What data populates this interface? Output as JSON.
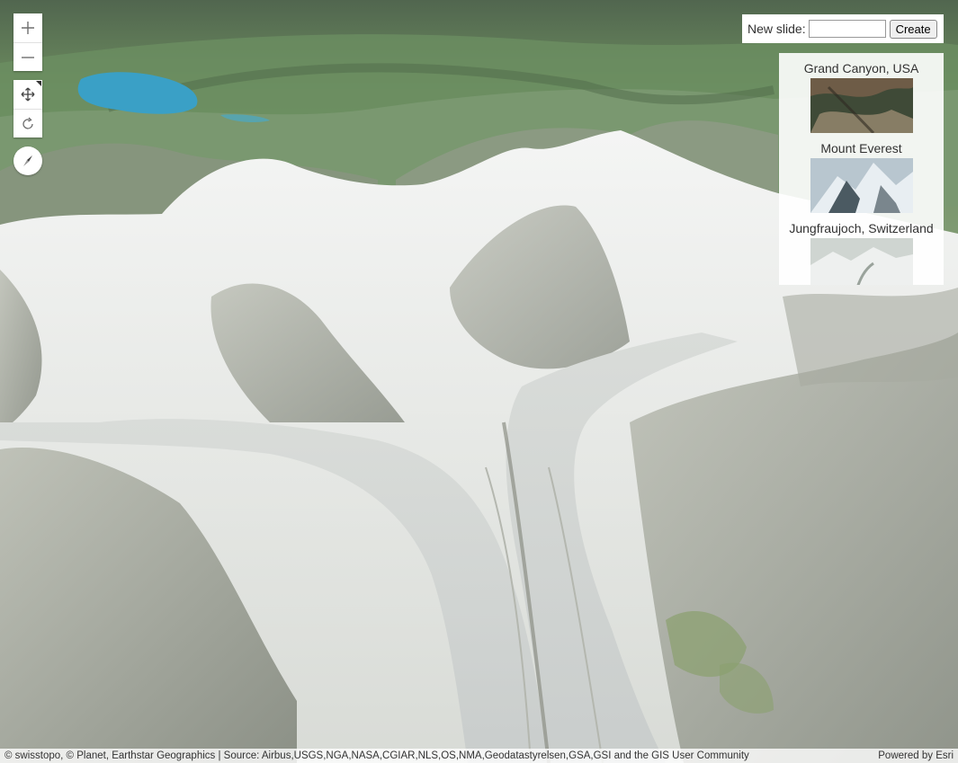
{
  "zoom": {
    "in_icon": "plus-icon",
    "out_icon": "minus-icon"
  },
  "navigation": {
    "pan_icon": "pan-arrows-icon",
    "rotate_icon": "rotate-icon",
    "compass_icon": "compass-icon"
  },
  "create_slide": {
    "label": "New slide:",
    "input_value": "",
    "button_label": "Create"
  },
  "slides": [
    {
      "title": "Grand Canyon, USA",
      "thumb_colors": [
        "#6e5c47",
        "#3f4a37",
        "#9a8a70"
      ]
    },
    {
      "title": "Mount Everest",
      "thumb_colors": [
        "#e8eef2",
        "#4b5a62",
        "#b8c6cf"
      ]
    },
    {
      "title": "Jungfraujoch, Switzerland",
      "thumb_colors": [
        "#eef0ef",
        "#9aa39c",
        "#cfd5d1"
      ]
    }
  ],
  "attribution": {
    "text": "© swisstopo, © Planet, Earthstar Geographics | Source: Airbus,USGS,NGA,NASA,CGIAR,NLS,OS,NMA,Geodatastyrelsen,GSA,GSI and the GIS User Community",
    "powered_by": "Powered by Esri"
  },
  "colors": {
    "lake": "#3aa0c6",
    "forest": "#5f7f55",
    "snow": "#eef0ee",
    "glacier": "#dfe2df",
    "rock": "#8f9288"
  }
}
